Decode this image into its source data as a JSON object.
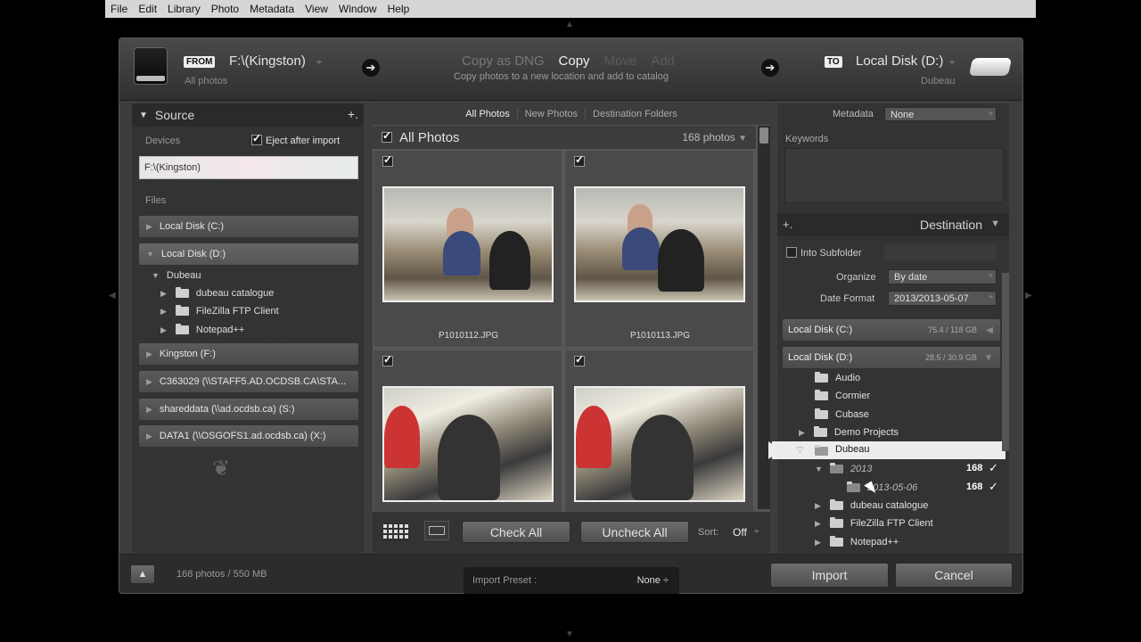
{
  "menu": [
    "File",
    "Edit",
    "Library",
    "Photo",
    "Metadata",
    "View",
    "Window",
    "Help"
  ],
  "header": {
    "from_tag": "FROM",
    "from_source": "F:\\(Kingston)",
    "from_updown": "÷",
    "from_sub": "All photos",
    "modes": [
      "Copy as DNG",
      "Copy",
      "Move",
      "Add"
    ],
    "mode_desc": "Copy photos to a new location and add to catalog",
    "to_tag": "TO",
    "to_dest": "Local Disk (D:)",
    "to_updown": "÷",
    "to_sub": "Dubeau",
    "arrow": "➔"
  },
  "source": {
    "title": "Source",
    "plus": "+.",
    "devices_label": "Devices",
    "eject_label": "Eject after import",
    "device": "F:\\(Kingston)",
    "files_label": "Files",
    "volumes_top": [
      "Local Disk (C:)",
      "Local Disk (D:)"
    ],
    "folder_root": "Dubeau",
    "folders": [
      "dubeau catalogue",
      "FileZilla FTP Client",
      "Notepad++"
    ],
    "volumes_bottom": [
      "Kingston (F:)",
      "C363029 (\\\\STAFF5.AD.OCDSB.CA\\STA...",
      "shareddata (\\\\ad.ocdsb.ca) (S:)",
      "DATA1 (\\\\OSGOFS1.ad.ocdsb.ca) (X:)"
    ],
    "ornament": "❦"
  },
  "grid": {
    "tabs": [
      "All Photos",
      "New Photos",
      "Destination Folders"
    ],
    "heading": "All Photos",
    "count": "168 photos",
    "files": [
      "P1010112.JPG",
      "P1010113.JPG",
      "",
      ""
    ],
    "check_all": "Check All",
    "uncheck_all": "Uncheck All",
    "sort_label": "Sort:",
    "sort_value": "Off",
    "sort_updown": "÷"
  },
  "destination": {
    "metadata_label": "Metadata",
    "metadata_value": "None",
    "keywords_label": "Keywords",
    "title": "Destination",
    "plus": "+.",
    "into_subfolder": "Into Subfolder",
    "organize_label": "Organize",
    "organize_value": "By date",
    "date_format_label": "Date Format",
    "date_format_value": "2013/2013-05-07",
    "vol_c": "Local Disk (C:)",
    "vol_c_cap": "75.4 / 118 GB",
    "vol_d": "Local Disk (D:)",
    "vol_d_cap": "28.5 / 30.9 GB",
    "folders": [
      "Audio",
      "Cormier",
      "Cubase",
      "Demo Projects",
      "Dubeau"
    ],
    "sub_year": "2013",
    "sub_date": "2013-05-06",
    "sub_count": "168",
    "more": [
      "dubeau catalogue",
      "FileZilla FTP Client",
      "Notepad++"
    ]
  },
  "footer": {
    "summary": "168 photos / 550 MB",
    "preset_label": "Import Preset :",
    "preset_value": "None",
    "preset_updown": "÷",
    "import": "Import",
    "cancel": "Cancel"
  }
}
